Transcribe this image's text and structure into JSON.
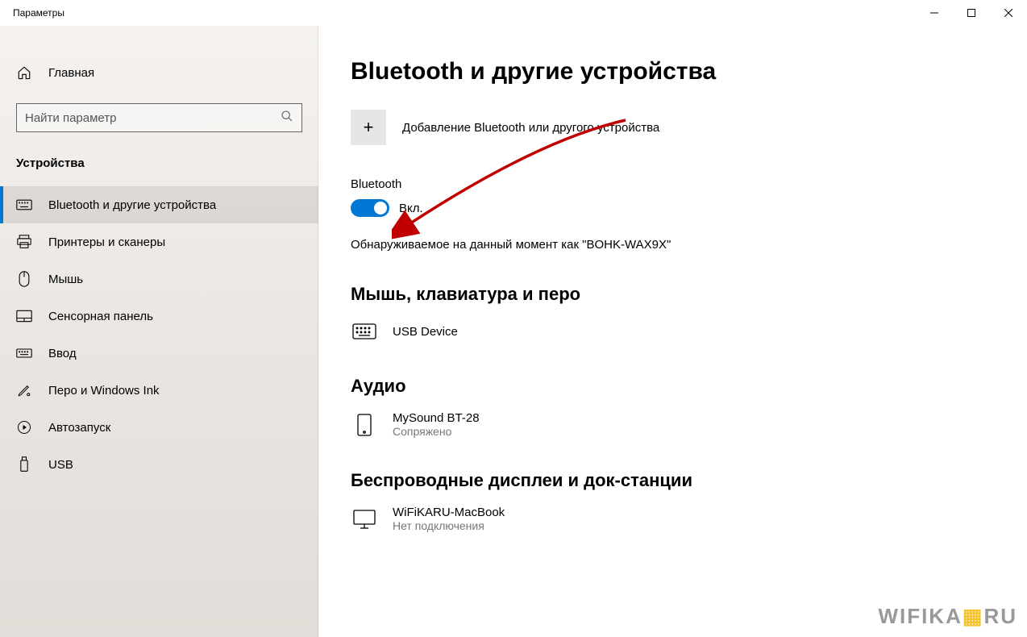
{
  "window": {
    "title": "Параметры"
  },
  "sidebar": {
    "home": "Главная",
    "search_placeholder": "Найти параметр",
    "section": "Устройства",
    "items": [
      {
        "label": "Bluetooth и другие устройства"
      },
      {
        "label": "Принтеры и сканеры"
      },
      {
        "label": "Мышь"
      },
      {
        "label": "Сенсорная панель"
      },
      {
        "label": "Ввод"
      },
      {
        "label": "Перо и Windows Ink"
      },
      {
        "label": "Автозапуск"
      },
      {
        "label": "USB"
      }
    ]
  },
  "content": {
    "title": "Bluetooth и другие устройства",
    "add_device": "Добавление Bluetooth или другого устройства",
    "bt_heading": "Bluetooth",
    "toggle_state": "Вкл.",
    "discoverable": "Обнаруживаемое на данный момент как \"BOHK-WAX9X\"",
    "groups": [
      {
        "title": "Мышь, клавиатура и перо",
        "devices": [
          {
            "name": "USB Device",
            "status": ""
          }
        ]
      },
      {
        "title": "Аудио",
        "devices": [
          {
            "name": "MySound BT-28",
            "status": "Сопряжено"
          }
        ]
      },
      {
        "title": "Беспроводные дисплеи и док-станции",
        "devices": [
          {
            "name": "WiFiKARU-MacBook",
            "status": "Нет подключения"
          }
        ]
      }
    ]
  },
  "watermark": {
    "part1": "WIFIKA",
    "part2": "▦",
    "part3": "RU"
  }
}
